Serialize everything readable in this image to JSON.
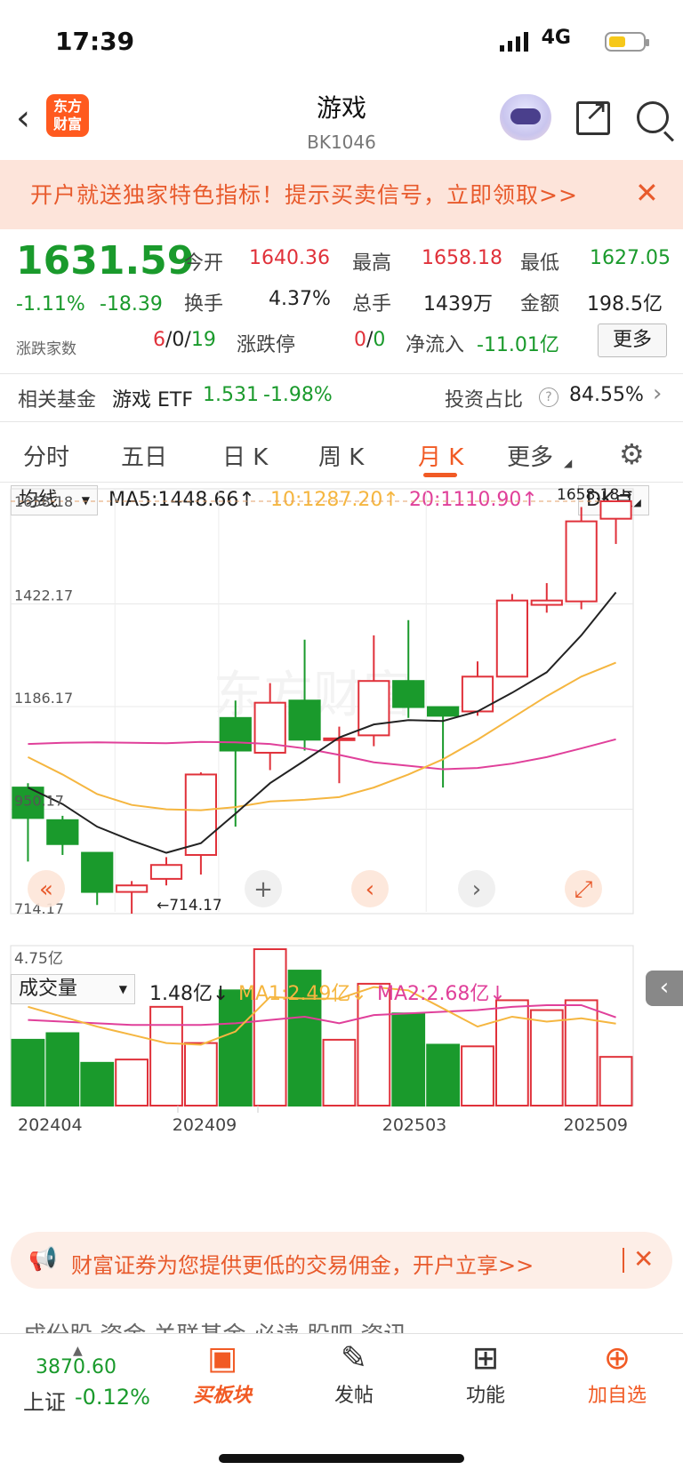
{
  "status": {
    "time": "17:39",
    "network": "4G"
  },
  "header": {
    "logo": "东方\n财富",
    "title": "游戏",
    "code": "BK1046"
  },
  "banner": {
    "text": "开户就送独家特色指标！提示买卖信号，立即领取>>"
  },
  "quote": {
    "price": "1631.59",
    "change_pct": "-1.11%",
    "change": "-18.39",
    "open_label": "今开",
    "open": "1640.36",
    "high_label": "最高",
    "high": "1658.18",
    "low_label": "最低",
    "low": "1627.05",
    "turnover_label": "换手",
    "turnover": "4.37%",
    "volume_label": "总手",
    "volume": "1439万",
    "amount_label": "金额",
    "amount": "198.5亿",
    "breadth_label": "涨跌家数",
    "up": "6",
    "flat": "0",
    "down": "19",
    "limit_label": "涨跌停",
    "limit_up": "0",
    "limit_down": "0",
    "netflow_label": "净流入",
    "netflow": "-11.01亿",
    "more": "更多"
  },
  "fund": {
    "label": "相关基金",
    "name": "游戏 ETF",
    "value": "1.531",
    "change": "-1.98%",
    "ratio_label": "投资占比",
    "ratio": "84.55%"
  },
  "tabs": [
    "分时",
    "五日",
    "日 K",
    "周 K",
    "月 K",
    "更多"
  ],
  "indicator": {
    "ma_select": "均线",
    "ma5": "MA5:1448.66↑",
    "ma10": "10:1287.20↑",
    "ma20": "20:1110.90↑",
    "dk": "DK点",
    "vol_select": "成交量",
    "vol": "1.48亿↓",
    "vma1": "MA1:2.49亿↓",
    "vma2": "MA2:2.68亿↓"
  },
  "colors": {
    "up": "#e0313a",
    "down": "#1a9a2c",
    "ma5": "#222222",
    "ma10": "#f5b640",
    "ma20": "#e0409a",
    "accent": "#f15a24"
  },
  "chart_data": {
    "type": "candlestick",
    "y_ticks": [
      "1658.18",
      "1422.17",
      "1186.17",
      "950.17",
      "714.17"
    ],
    "ylim": [
      714.17,
      1658.18
    ],
    "max_label": "1658.18→",
    "min_label": "←714.17",
    "x_ticks": [
      "202404",
      "202409",
      "202503",
      "202509"
    ],
    "vol_max_label": "4.75亿",
    "candles": [
      {
        "o": 1000,
        "c": 930,
        "h": 1010,
        "l": 830
      },
      {
        "o": 925,
        "c": 870,
        "h": 935,
        "l": 845
      },
      {
        "o": 850,
        "c": 760,
        "h": 850,
        "l": 730
      },
      {
        "o": 760,
        "c": 775,
        "h": 785,
        "l": 710
      },
      {
        "o": 790,
        "c": 822,
        "h": 840,
        "l": 775
      },
      {
        "o": 845,
        "c": 1030,
        "h": 1035,
        "l": 800
      },
      {
        "o": 1160,
        "c": 1085,
        "h": 1200,
        "l": 910
      },
      {
        "o": 1080,
        "c": 1195,
        "h": 1240,
        "l": 1040
      },
      {
        "o": 1200,
        "c": 1110,
        "h": 1340,
        "l": 1085
      },
      {
        "o": 1113,
        "c": 1113,
        "h": 1140,
        "l": 1010
      },
      {
        "o": 1120,
        "c": 1245,
        "h": 1350,
        "l": 1095
      },
      {
        "o": 1245,
        "c": 1185,
        "h": 1385,
        "l": 1160
      },
      {
        "o": 1185,
        "c": 1165,
        "h": 1185,
        "l": 1000
      },
      {
        "o": 1175,
        "c": 1255,
        "h": 1290,
        "l": 1165
      },
      {
        "o": 1255,
        "c": 1430,
        "h": 1445,
        "l": 1255
      },
      {
        "o": 1420,
        "c": 1430,
        "h": 1470,
        "l": 1402
      },
      {
        "o": 1428,
        "c": 1612,
        "h": 1645,
        "l": 1410
      },
      {
        "o": 1618,
        "c": 1658.18,
        "h": 1658.18,
        "l": 1560
      }
    ],
    "ma5": [
      1000,
      962,
      910,
      878,
      850,
      872,
      940,
      1010,
      1062,
      1115,
      1145,
      1155,
      1153,
      1175,
      1218,
      1265,
      1350,
      1448.66
    ],
    "ma10": [
      1070,
      1030,
      985,
      960,
      950,
      948,
      955,
      968,
      972,
      978,
      1000,
      1030,
      1065,
      1110,
      1160,
      1210,
      1255,
      1287.2
    ],
    "ma20": [
      1100,
      1103,
      1104,
      1103,
      1102,
      1105,
      1104,
      1100,
      1090,
      1075,
      1058,
      1050,
      1042,
      1045,
      1055,
      1070,
      1090,
      1110.9
    ],
    "volume": [
      2.0,
      2.2,
      1.3,
      1.4,
      3.0,
      1.9,
      3.5,
      4.75,
      4.1,
      2.0,
      3.7,
      2.8,
      1.85,
      1.8,
      3.2,
      2.9,
      3.2,
      1.48
    ],
    "vol_ma1": [
      3.0,
      2.7,
      2.4,
      2.15,
      1.9,
      1.85,
      2.25,
      3.3,
      3.25,
      3.25,
      3.6,
      3.5,
      2.95,
      2.4,
      2.7,
      2.55,
      2.65,
      2.49
    ],
    "vol_ma2": [
      2.6,
      2.55,
      2.5,
      2.45,
      2.45,
      2.45,
      2.5,
      2.6,
      2.7,
      2.5,
      2.75,
      2.8,
      2.85,
      2.9,
      3.0,
      3.05,
      3.05,
      2.68
    ],
    "vol_max": 4.75
  },
  "promo": {
    "text": "财富证券为您提供更低的交易佣金，开户立享>>"
  },
  "subtabs": "成份股    资金    关联基金    必读        股吧        资讯",
  "bottom": {
    "index_value": "3870.60",
    "index_name": "上证",
    "index_change": "-0.12%",
    "items": [
      "买板块",
      "发帖",
      "功能",
      "加自选"
    ]
  }
}
